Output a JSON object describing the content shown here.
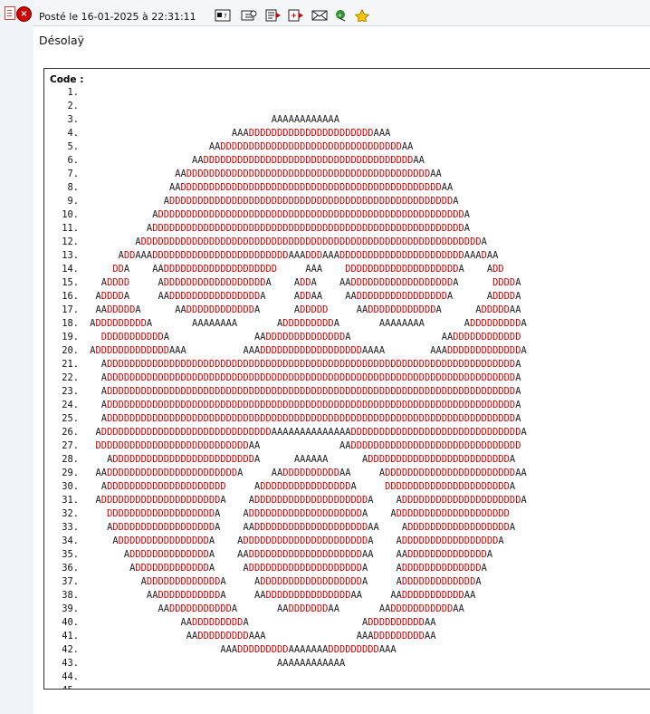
{
  "post": {
    "meta": "Posté le 16-01-2025 à 22:31:11",
    "message": "Désolaÿ",
    "code_label": "Code :"
  },
  "icons": [
    "profile-icon",
    "quote-icon",
    "edit-icon",
    "add-icon",
    "email-icon",
    "alert-icon",
    "favorite-star-icon"
  ],
  "code_lines": [
    "",
    "",
    "AAAAAAAAAAAA",
    "AAADDDDDDDDDDDDDDDDDDDDDDAAA",
    "AADDDDDDDDDDDDDDDDDDDDDDDDDDDDDDDDAA",
    "AADDDDDDDDDDDDDDDDDDDDDDDDDDDDDDDDDDDDDAA",
    "AADDDDDDDDDDDDDDDDDDDDDDDDDDDDDDDDDDDDDDDDDDDAA",
    "AADDDDDDDDDDDDDDDDDDDDDDDDDDDDDDDDDDDDDDDDDDDDDDAA",
    "ADDDDDDDDDDDDDDDDDDDDDDDDDDDDDDDDDDDDDDDDDDDDDDDDDDA",
    "ADDDDDDDDDDDDDDDDDDDDDDDDDDDDDDDDDDDDDDDDDDDDDDDDDDDDDDA",
    "ADDDDDDDDDDDDDDDDDDDDDDDDDDDDDDDDDDDDDDDDDDDDDDDDDDDDDDDA",
    "ADDDDDDDDDDDDDDDDDDDDDDDDDDDDDDDDDDDDDDDDDDDDDDDDDDDDDDDDDDDDA",
    "ADDAAADDDDDDDDDDDDDDDDDDDDDDDDAAADDDAAADDDDDDDDDDDDDDDDDDDDDDAAADAA",
    "DDA    AADDDDDDDDDDDDDDDDDDDD     AAA    DDDDDDDDDDDDDDDDDDDDA    ADD",
    "ADDDD     ADDDDDDDDDDDDDDDDDDA    ADDA    AADDDDDDDDDDDDDDDDDDA      DDDDA",
    "ADDDDA     AADDDDDDDDDDDDDDDDA     ADDAA    AADDDDDDDDDDDDDDDDA      ADDDDA",
    "AADDDDDA      AADDDDDDDDDDDDA      ADDDDD     AADDDDDDDDDDDDA      ADDDDDAA",
    "ADDDDDDDDDA       AAAAAAAA       ADDDDDDDDDA       AAAAAAAA       ADDDDDDDDDA",
    "DDDDDDDDDDDA               AADDDDDDDDDDDDDDA                AADDDDDDDDDDDD",
    "ADDDDDDDDDDDDDAAA          AAADDDDDDDDDDDDDDDDDDAAAA        AAADDDDDDDDDDDDDA",
    "ADDDDDDDDDDDDDDDDDDDDDDDDDDDDDDDDDDDDDDDDDDDDDDDDDDDDDDDDDDDDDDDDDDDDDDDDA",
    "ADDDDDDDDDDDDDDDDDDDDDDDDDDDDDDDDDDDDDDDDDDDDDDDDDDDDDDDDDDDDDDDDDDDDDDDDA",
    "ADDDDDDDDDDDDDDDDDDDDDDDDDDDDDDDDDDDDDDDDDDDDDDDDDDDDDDDDDDDDDDDDDDDDDDDDA",
    "ADDDDDDDDDDDDDDDDDDDDDDDDDDDDDDDDDDDDDDDDDDDDDDDDDDDDDDDDDDDDDDDDDDDDDDDDA",
    "ADDDDDDDDDDDDDDDDDDDDDDDDDDDDDDDDDDDDDDDDDDDDDDDDDDDDDDDDDDDDDDDDDDDDDDDDA",
    "ADDDDDDDDDDDDDDDDDDDDDDDDDDDDDDAAAAAAAAAAAAAADDDDDDDDDDDDDDDDDDDDDDDDDDDDDDA",
    "DDDDDDDDDDDDDDDDDDDDDDDDDDDAA              AADDDDDDDDDDDDDDDDDDDDDDDDDDDDDD",
    "ADDDDDDDDDDDDDDDDDDDDDDDDDA      AAAAAA      ADDDDDDDDDDDDDDDDDDDDDDDDDA",
    "AADDDDDDDDDDDDDDDDDDDDDDDA     AADDDDDDDDDDAA     ADDDDDDDDDDDDDDDDDDDDDDDAA",
    "ADDDDDDDDDDDDDDDDDDDDD     ADDDDDDDDDDDDDDDDA     DDDDDDDDDDDDDDDDDDDDDDA",
    "ADDDDDDDDDDDDDDDDDDDDDA    ADDDDDDDDDDDDDDDDDDDDA    ADDDDDDDDDDDDDDDDDDDDDA",
    "DDDDDDDDDDDDDDDDDDDA    ADDDDDDDDDDDDDDDDDDDDA    ADDDDDDDDDDDDDDDDDDDD",
    "ADDDDDDDDDDDDDDDDDDA    AADDDDDDDDDDDDDDDDDDDDAA    ADDDDDDDDDDDDDDDDDDA",
    "ADDDDDDDDDDDDDDDDA    ADDDDDDDDDDDDDDDDDDDDDDA    ADDDDDDDDDDDDDDDDDA",
    "ADDDDDDDDDDDDDDA    AADDDDDDDDDDDDDDDDDDDDAA    AADDDDDDDDDDDDDDA",
    "ADDDDDDDDDDDDDA     ADDDDDDDDDDDDDDDDDDDDA     ADDDDDDDDDDDDDDA",
    "ADDDDDDDDDDDDDA     ADDDDDDDDDDDDDDDDDDA     ADDDDDDDDDDDDDA",
    "AADDDDDDDDDDDA     AADDDDDDDDDDDDDDDAA     AADDDDDDDDDDDAA",
    "AADDDDDDDDDDDA       AADDDDDDDAA       AADDDDDDDDDDDAA",
    "AADDDDDDDDDA                    ADDDDDDDDDDAA",
    "AADDDDDDDDDAAA                AAADDDDDDDDDAA",
    "AAADDDDDDDDDAAAAAAADDDDDDDDDAAA",
    "AAAAAAAAAAAA",
    "",
    ""
  ],
  "colors": {
    "ascii_a": "#222222",
    "ascii_d": "#d00000"
  }
}
